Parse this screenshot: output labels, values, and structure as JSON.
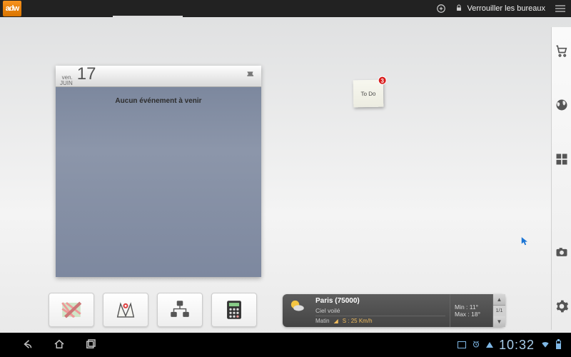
{
  "topbar": {
    "logo_text": "adw",
    "lock_label": "Verrouiller les bureaux"
  },
  "calendar": {
    "dow": "ven.",
    "month": "JUIN",
    "day_number": "17",
    "no_events": "Aucun événement à venir"
  },
  "sticky": {
    "label": "To Do",
    "badge_count": "3"
  },
  "weather": {
    "city": "Paris (75000)",
    "condition": "Ciel voilé",
    "period": "Matin",
    "wind_label": "S : 25 Km/h",
    "min_label": "Min : 11°",
    "max_label": "Max : 18°",
    "page": "1/1"
  },
  "dock": {
    "items": [
      "cart-icon",
      "globe-icon",
      "grid-icon",
      "camera-icon",
      "gear-icon"
    ]
  },
  "navbar": {
    "time": "10:32"
  }
}
